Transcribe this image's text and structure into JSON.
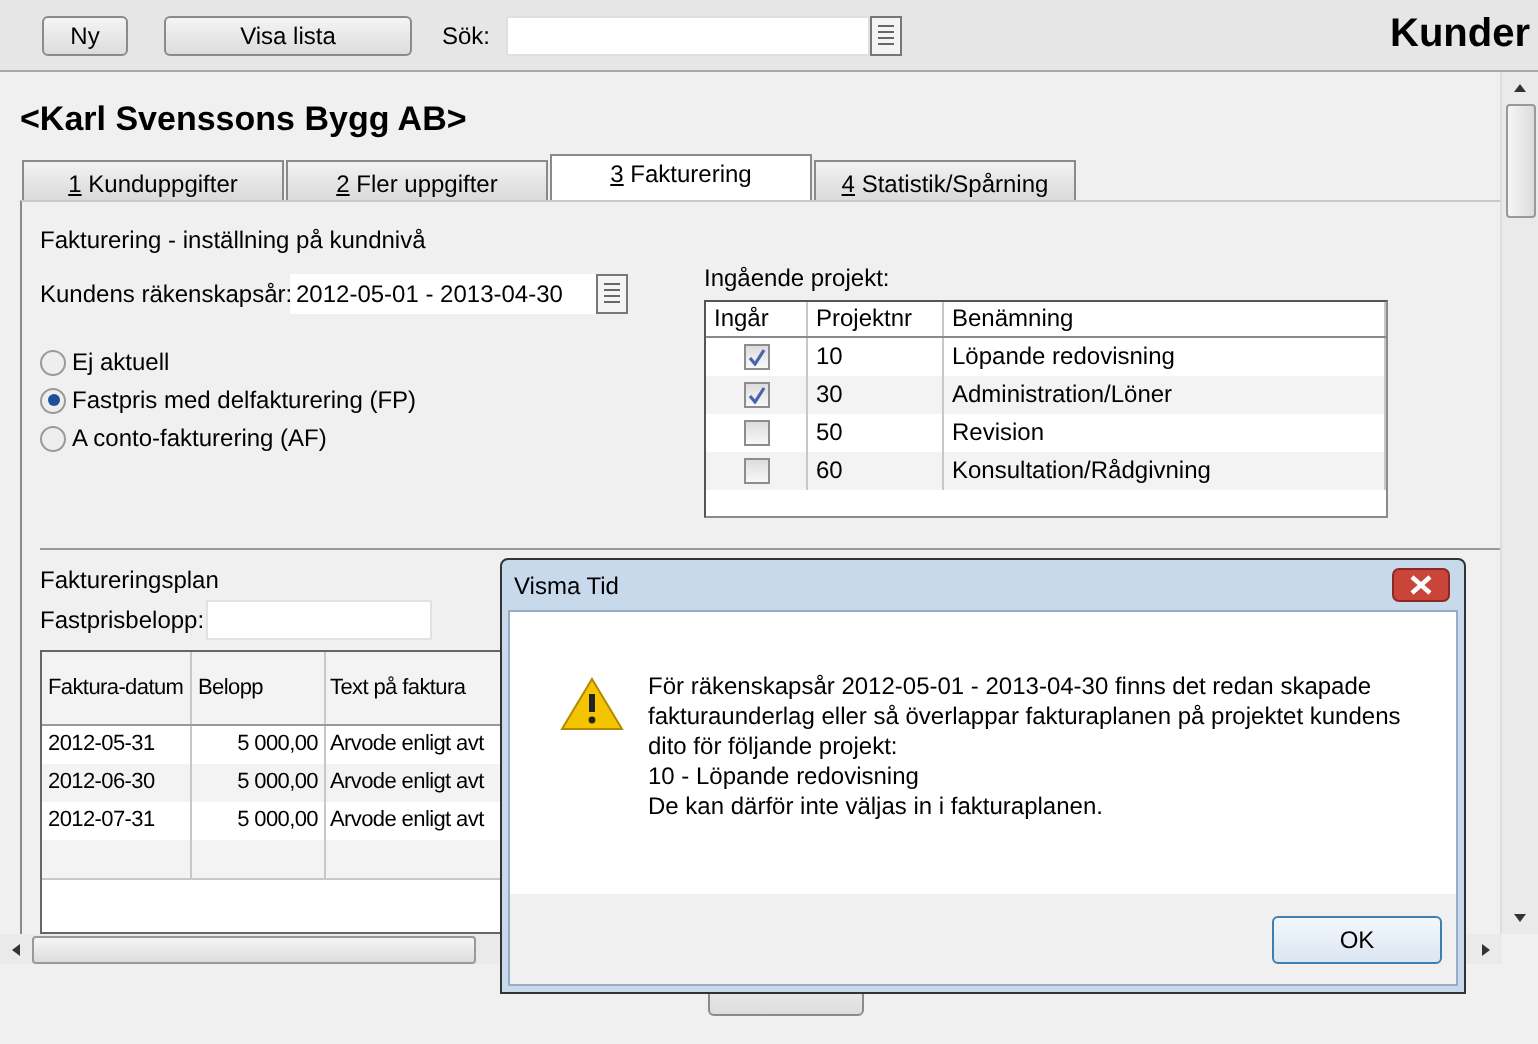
{
  "toolbar": {
    "buttons": [
      "Ny",
      "Visa lista"
    ],
    "search_label": "Sök:",
    "heading": "Kunder"
  },
  "customer_title": "<Karl Svenssons Bygg AB>",
  "tabs": [
    {
      "label": "1 Kunduppgifter",
      "selected": false
    },
    {
      "label": "2 Fler uppgifter",
      "selected": false
    },
    {
      "label": "3 Fakturering",
      "selected": true
    },
    {
      "label": "4 Statistik/Spårning",
      "selected": false
    }
  ],
  "settings": {
    "section_title": "Fakturering - inställning på kundnivå",
    "fiscal_year_label": "Kundens räkenskapsår:",
    "fiscal_year_value": "2012-05-01 - 2013-04-30",
    "radios": [
      {
        "label": "Ej aktuell",
        "selected": false
      },
      {
        "label": "Fastpris med delfakturering (FP)",
        "selected": true
      },
      {
        "label": "A conto-fakturering (AF)",
        "selected": false
      }
    ]
  },
  "projects": {
    "label": "Ingående projekt:",
    "columns": [
      "Ingår",
      "Projektnr",
      "Benämning"
    ],
    "rows": [
      {
        "included": true,
        "number": "10",
        "name": "Löpande redovisning"
      },
      {
        "included": true,
        "number": "30",
        "name": "Administration/Löner"
      },
      {
        "included": false,
        "number": "50",
        "name": "Revision"
      },
      {
        "included": false,
        "number": "60",
        "name": "Konsultation/Rådgivning"
      }
    ]
  },
  "plan": {
    "title": "Faktureringsplan",
    "fixed_price_label": "Fastprisbelopp:",
    "columns": [
      "Faktura-datum",
      "Belopp",
      "Text på faktura"
    ],
    "rows": [
      {
        "date": "2012-05-31",
        "amount": "5 000,00",
        "text": "Arvode enligt avt"
      },
      {
        "date": "2012-06-30",
        "amount": "5 000,00",
        "text": "Arvode enligt avt"
      },
      {
        "date": "2012-07-31",
        "amount": "5 000,00",
        "text": "Arvode enligt avt"
      }
    ]
  },
  "dialog": {
    "title": "Visma Tid",
    "message": [
      "För räkenskapsår 2012-05-01 - 2013-04-30 finns det redan skapade",
      "fakturaunderlag eller så överlappar fakturaplanen på projektet kundens",
      "dito för följande projekt:",
      "10 - Löpande redovisning",
      "De kan därför inte väljas in i fakturaplanen."
    ],
    "button": "OK"
  }
}
